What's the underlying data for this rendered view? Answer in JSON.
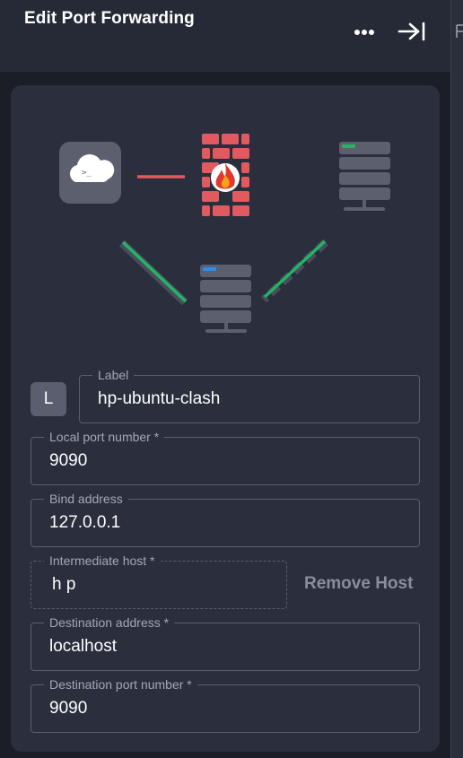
{
  "header": {
    "title": "Edit Port Forwarding",
    "more_icon": "more-horizontal-icon",
    "close_icon": "collapse-panel-icon"
  },
  "diagram": {
    "nodes": [
      "terminal-cloud-icon",
      "firewall-icon",
      "remote-server-icon",
      "intermediate-server-icon"
    ],
    "colors": {
      "line_red": "#e05a5f",
      "line_green": "#22b564",
      "brick": "#e05a5f",
      "server": "#5b5f6e"
    }
  },
  "form": {
    "label_badge": "L",
    "label": {
      "label": "Label",
      "value": "hp-ubuntu-clash"
    },
    "local_port": {
      "label": "Local port number *",
      "value": "9090"
    },
    "bind_address": {
      "label": "Bind address",
      "value": "127.0.0.1"
    },
    "intermediate_host": {
      "label": "Intermediate host *",
      "value": "h p"
    },
    "remove_host_label": "Remove Host",
    "destination_address": {
      "label": "Destination address *",
      "value": "localhost"
    },
    "destination_port": {
      "label": "Destination port number *",
      "value": "9090"
    }
  }
}
